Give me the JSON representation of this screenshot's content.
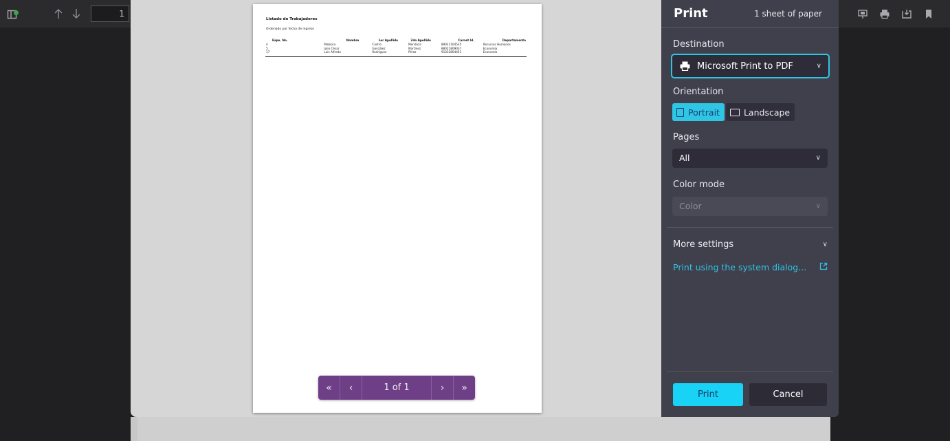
{
  "toolbar": {
    "page_number": "1"
  },
  "document": {
    "title": "Listado de Trabajadores",
    "subtitle": "Ordenado por fecha de ingreso",
    "columns": [
      "Expe. No.",
      "Nombre",
      "1er Apellido",
      "2do Apellido",
      "Carnet Id.",
      "Departamento"
    ],
    "rows": [
      [
        "4",
        "Mabiora",
        "Castro",
        "Mendoza",
        "89021104535",
        "Recursos Humanos"
      ],
      [
        "5",
        "Julio César",
        "González",
        "Martínez",
        "88021809037",
        "Economía"
      ],
      [
        "17",
        "Luis Alfredo",
        "Rodríguez",
        "Pérez",
        "91032804451",
        "Economía"
      ]
    ]
  },
  "pager": {
    "page_text": "1 of 1",
    "first_icon": "«",
    "prev_icon": "‹",
    "next_icon": "›",
    "last_icon": "»"
  },
  "print_panel": {
    "title": "Print",
    "sheet_count": "1 sheet of paper",
    "destination_label": "Destination",
    "destination_value": "Microsoft Print to PDF",
    "orientation_label": "Orientation",
    "orientation_portrait": "Portrait",
    "orientation_landscape": "Landscape",
    "orientation_selected": "Portrait",
    "pages_label": "Pages",
    "pages_value": "All",
    "color_label": "Color mode",
    "color_value": "Color",
    "more_settings": "More settings",
    "system_dialog_link": "Print using the system dialog...",
    "print_button": "Print",
    "cancel_button": "Cancel"
  },
  "colors": {
    "accent": "#19d3f6",
    "panel_bg": "#403f4c",
    "pager_bg": "#6e3f86",
    "status_dot": "#3aa84a"
  }
}
